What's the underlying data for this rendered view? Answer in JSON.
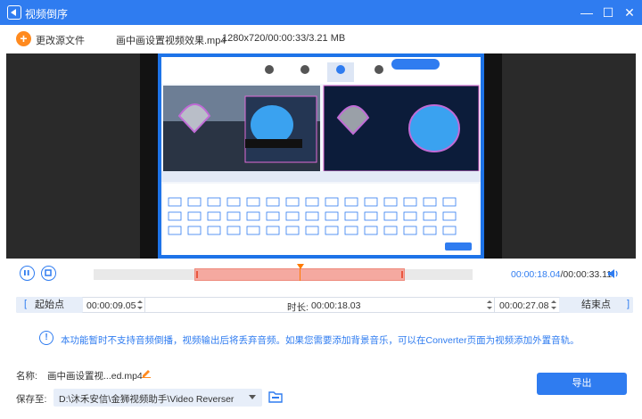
{
  "window": {
    "title": "视频倒序",
    "minimize_glyph": "—",
    "maximize_glyph": "☐",
    "close_glyph": "✕"
  },
  "toolbar": {
    "add_icon_glyph": "+",
    "change_source_label": "更改源文件",
    "file_name": "画中画设置视频效果.mp4",
    "file_info": "1280x720/00:00:33/3.21 MB"
  },
  "player": {
    "current_time": "00:00:18.04",
    "separator": "/",
    "total_time": "00:00:33.11",
    "selection_start_fraction": 0.266,
    "selection_end_fraction": 0.821,
    "playhead_fraction": 0.541
  },
  "range": {
    "start_button": "起始点",
    "start_bracket": "[",
    "start_time": "00:00:09.05",
    "duration_label": "时长:",
    "duration_value": "00:00:18.03",
    "end_time": "00:00:27.08",
    "end_bracket": "]",
    "end_button": "结束点"
  },
  "notice": {
    "icon_glyph": "!",
    "text": "本功能暂时不支持音频倒播，视频输出后将丢弃音频。如果您需要添加背景音乐，可以在Converter页面为视频添加外置音轨。"
  },
  "output": {
    "name_label": "名称:",
    "name_value": "画中画设置视...ed.mp4",
    "save_label": "保存至:",
    "save_path": "D:\\沐禾安信\\金狮视频助手\\Video Reverser",
    "export_button": "导出"
  },
  "colors": {
    "accent": "#2f7cf0",
    "orange": "#ff8a1f",
    "selection": "#f5a9a0"
  }
}
